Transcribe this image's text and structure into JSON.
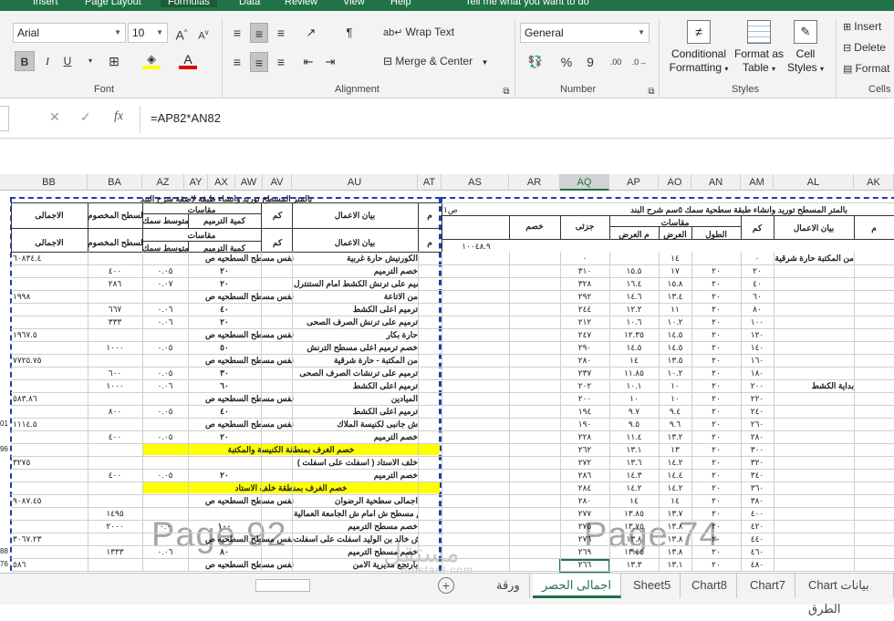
{
  "ribbon_tabs": [
    "Insert",
    "Page Layout",
    "Formulas",
    "Data",
    "Review",
    "View",
    "Help",
    "Tell me what you want to do"
  ],
  "font": {
    "name": "Arial",
    "size": "10",
    "group_label": "Font",
    "bold": "B",
    "italic": "I",
    "underline": "U",
    "grow": "A",
    "shrink": "A"
  },
  "alignment": {
    "wrap_text": "Wrap Text",
    "merge_center": "Merge & Center",
    "group_label": "Alignment"
  },
  "number": {
    "format": "General",
    "percent": "%",
    "comma": "9",
    "inc_dec": ".00",
    "group_label": "Number"
  },
  "styles": {
    "conditional": "Conditional",
    "conditional2": "Formatting",
    "format_as": "Format as",
    "table": "Table",
    "cell": "Cell",
    "cell_styles": "Styles",
    "group_label": "Styles"
  },
  "cells": {
    "insert": "Insert",
    "delete": "Delete",
    "format": "Format",
    "group_label": "Cells"
  },
  "formula_bar": {
    "formula": "=AP82*AN82",
    "fx": "fx"
  },
  "columns": [
    "BB",
    "BA",
    "AZ",
    "AY",
    "AX",
    "AW",
    "AV",
    "AU",
    "AT",
    "AS",
    "AR",
    "AQ",
    "AP",
    "AO",
    "AN",
    "AM",
    "AL",
    "AK"
  ],
  "left_page": {
    "title": "بالمتر المسطح توريد وانشاء طبقة لاصقة شرح البند",
    "headers": {
      "total": "الاجمالى",
      "flat": "السطح المخصوم",
      "quantities": "مقاسات",
      "thickness": "متوسط سمك",
      "restore": "كمية الترميم",
      "km": "كم",
      "items": "بيان الاعمال",
      "m": "م"
    },
    "rows": [
      {
        "total": "٦٠٨٣٤.٤",
        "flat": "",
        "a": "",
        "b": "",
        "label": "الكورنيش حارة غربية",
        "note": "نفس مسطح السطحيه ص"
      },
      {
        "total": "",
        "flat": "٤٠٠",
        "a": "٠.٠٥",
        "b": "٢٠",
        "label": "خصم الترميم",
        "note": ""
      },
      {
        "total": "",
        "flat": "٢٨٦",
        "a": "٠.٠٧",
        "b": "٢٠",
        "label": "ترميم على ترنش الكشط امام الستنترل",
        "note": ""
      },
      {
        "total": "١٩٩٨",
        "flat": "",
        "a": "",
        "b": "",
        "label": "من الاتاعة",
        "note": "نفس مسطح السطحيه ص"
      },
      {
        "total": "",
        "flat": "٦٦٧",
        "a": "٠.٠٦",
        "b": "٤٠",
        "label": "ترميم اعلى الكشط",
        "note": ""
      },
      {
        "total": "",
        "flat": "٣٣٣",
        "a": "٠.٠٦",
        "b": "٢٠",
        "label": "ترميم على ترنش الصرف الصحى",
        "note": ""
      },
      {
        "total": "١٩٦٧.٥",
        "flat": "",
        "a": "",
        "b": "",
        "label": "حارة بكار",
        "note": "نفس مسطح السطحيه ص"
      },
      {
        "total": "",
        "flat": "١٠٠٠",
        "a": "٠.٠٥",
        "b": "٥٠",
        "label": "خصم ترميم اعلى مسطح الترنش",
        "note": ""
      },
      {
        "total": "٧٧٢٥.٧٥",
        "flat": "",
        "a": "",
        "b": "",
        "label": "من المكتبة - حارة شرقية",
        "note": "نفس مسطح السطحيه ص"
      },
      {
        "total": "",
        "flat": "٦٠٠",
        "a": "٠.٠٥",
        "b": "٣٠",
        "label": "ترميم على ترنشات الصرف الصحى",
        "note": ""
      },
      {
        "total": "",
        "flat": "١٠٠٠",
        "a": "٠.٠٦",
        "b": "٦٠",
        "label": "ترميم اعلى الكشط",
        "note": ""
      },
      {
        "total": "٥٨٣.٨٦",
        "flat": "",
        "a": "",
        "b": "",
        "label": "الميادين",
        "note": "نفس مسطح السطحيه ص"
      },
      {
        "total": "",
        "flat": "٨٠٠",
        "a": "٠.٠٥",
        "b": "٤٠",
        "label": "ترميم اعلى الكشط",
        "note": ""
      },
      {
        "total": "١١١٤.٥",
        "flat": "",
        "a": "",
        "b": "",
        "label": "ش جانبى لكنيسة الملاك",
        "note": "نفس مسطح السطحيه ص"
      },
      {
        "total": "",
        "flat": "٤٠٠",
        "a": "٠.٠٥",
        "b": "٢٠",
        "label": "خصم الترميم",
        "note": ""
      },
      {
        "total": "",
        "flat": "",
        "a": "",
        "b": "",
        "label": "",
        "note": "",
        "yellow": "خصم الغرف بمنطقة الكنيسة والمكتبة"
      },
      {
        "total": "٣٢٧٥",
        "flat": "",
        "a": "",
        "b": "",
        "label": "خلف الاستاد ( اسفلت على اسفلت )",
        "note": ""
      },
      {
        "total": "",
        "flat": "٤٠٠",
        "a": "٠.٠٥",
        "b": "٢٠",
        "label": "خصم الترميم",
        "note": ""
      },
      {
        "total": "",
        "flat": "",
        "a": "",
        "b": "",
        "label": "",
        "note": "",
        "yellow": "خصم الغرف بمنطقة خلف الاستاد"
      },
      {
        "total": "٩٠٨٧.٤٥",
        "flat": "",
        "a": "",
        "b": "",
        "label": "اجمالى سطحية الرضوان",
        "note": "نفس مسطح السطحيه ص"
      },
      {
        "total": "",
        "flat": "١٤٩٥",
        "a": "",
        "b": "",
        "label": "خصم مسطح ش امام ش الجامعة العمالية",
        "note": ""
      },
      {
        "total": "",
        "flat": "٢٠٠٠",
        "a": "٠.٠",
        "b": "١٠٠",
        "label": "خصم مسطح الترميم",
        "note": ""
      },
      {
        "total": "٣٠٦٧.٢٣",
        "flat": "",
        "a": "",
        "b": "",
        "label": "سطح ش خالد بن الوليد اسفلت على اسفلت",
        "note": "نفس مسطح السطحيه ص"
      },
      {
        "total": "",
        "flat": "١٣٣٣",
        "a": "٠.٠٦",
        "b": "٨٠",
        "label": "خصم مسطح الترميم",
        "note": ""
      },
      {
        "total": "٥٨٦",
        "flat": "",
        "a": "",
        "b": "",
        "label": "بارتجع مديرية الامن",
        "note": "نفس مسطح السطحيه ص"
      }
    ],
    "left_edge": [
      "",
      "",
      "",
      "",
      "",
      "",
      "",
      "",
      "",
      "",
      "",
      "",
      "",
      "01",
      "",
      "96",
      "",
      "",
      "",
      "",
      "",
      "",
      "",
      "88",
      "76"
    ]
  },
  "right_page": {
    "title": "بالمتر المسطح توريد وانشاء طبقة سطحية سمك ٥سم شرح البند",
    "page_ref": "ص١",
    "headers": {
      "deduct": "خصم",
      "partial": "جزئى",
      "quantities": "مقاسات",
      "avg_width": "م العرض",
      "width": "العرض",
      "length": "الطول",
      "km": "كم",
      "items": "بيان الاعمال",
      "m": "م"
    },
    "subtotal": "١٠٠٤٨.٩",
    "rows": [
      {
        "aq": "٠",
        "ap": "",
        "ao": "١٤",
        "an": "",
        "am": "٠",
        "al": "من المكتبة حارة شرقية"
      },
      {
        "aq": "٣١٠",
        "ap": "١٥.٥",
        "ao": "١٧",
        "an": "٢٠",
        "am": "٢٠",
        "al": ""
      },
      {
        "aq": "٣٢٨",
        "ap": "١٦.٤",
        "ao": "١٥.٨",
        "an": "٢٠",
        "am": "٤٠",
        "al": ""
      },
      {
        "aq": "٢٩٢",
        "ap": "١٤.٦",
        "ao": "١٣.٤",
        "an": "٢٠",
        "am": "٦٠",
        "al": ""
      },
      {
        "aq": "٢٤٤",
        "ap": "١٢.٢",
        "ao": "١١",
        "an": "٢٠",
        "am": "٨٠",
        "al": ""
      },
      {
        "aq": "٢١٢",
        "ap": "١٠.٦",
        "ao": "١٠.٢",
        "an": "٢٠",
        "am": "١٠٠",
        "al": ""
      },
      {
        "aq": "٢٤٧",
        "ap": "١٢.٣٥",
        "ao": "١٤.٥",
        "an": "٢٠",
        "am": "١٢٠",
        "al": ""
      },
      {
        "aq": "٢٩٠",
        "ap": "١٤.٥",
        "ao": "١٤.٥",
        "an": "٢٠",
        "am": "١٤٠",
        "al": ""
      },
      {
        "aq": "٢٨٠",
        "ap": "١٤",
        "ao": "١٣.٥",
        "an": "٢٠",
        "am": "١٦٠",
        "al": ""
      },
      {
        "aq": "٢٣٧",
        "ap": "١١.٨٥",
        "ao": "١٠.٢",
        "an": "٢٠",
        "am": "١٨٠",
        "al": ""
      },
      {
        "aq": "٢٠٢",
        "ap": "١٠.١",
        "ao": "١٠",
        "an": "٢٠",
        "am": "٢٠٠",
        "al": "بداية الكشط"
      },
      {
        "aq": "٢٠٠",
        "ap": "١٠",
        "ao": "١٠",
        "an": "٢٠",
        "am": "٢٢٠",
        "al": ""
      },
      {
        "aq": "١٩٤",
        "ap": "٩.٧",
        "ao": "٩.٤",
        "an": "٢٠",
        "am": "٢٤٠",
        "al": ""
      },
      {
        "aq": "١٩٠",
        "ap": "٩.٥",
        "ao": "٩.٦",
        "an": "٢٠",
        "am": "٢٦٠",
        "al": ""
      },
      {
        "aq": "٢٢٨",
        "ap": "١١.٤",
        "ao": "١٣.٢",
        "an": "٢٠",
        "am": "٢٨٠",
        "al": ""
      },
      {
        "aq": "٢٦٢",
        "ap": "١٣.١",
        "ao": "١٣",
        "an": "٢٠",
        "am": "٣٠٠",
        "al": ""
      },
      {
        "aq": "٢٧٢",
        "ap": "١٣.٦",
        "ao": "١٤.٢",
        "an": "٢٠",
        "am": "٣٢٠",
        "al": ""
      },
      {
        "aq": "٢٨٦",
        "ap": "١٤.٣",
        "ao": "١٤.٤",
        "an": "٢٠",
        "am": "٣٤٠",
        "al": ""
      },
      {
        "aq": "٢٨٤",
        "ap": "١٤.٢",
        "ao": "١٤.٢",
        "an": "٢٠",
        "am": "٣٦٠",
        "al": ""
      },
      {
        "aq": "٢٨٠",
        "ap": "١٤",
        "ao": "١٤",
        "an": "٢٠",
        "am": "٣٨٠",
        "al": ""
      },
      {
        "aq": "٢٧٧",
        "ap": "١٣.٨٥",
        "ao": "١٣.٧",
        "an": "٢٠",
        "am": "٤٠٠",
        "al": ""
      },
      {
        "aq": "٢٧٥",
        "ap": "١٣.٧٥",
        "ao": "١٣.٨",
        "an": "٢٠",
        "am": "٤٢٠",
        "al": ""
      },
      {
        "aq": "٢٧٦",
        "ap": "١٣.٨",
        "ao": "١٣.٨",
        "an": "٢٠",
        "am": "٤٤٠",
        "al": ""
      },
      {
        "aq": "٢٦٩",
        "ap": "١٣.٤٥",
        "ao": "١٣.٨",
        "an": "٢٠",
        "am": "٤٦٠",
        "al": ""
      },
      {
        "aq": "٢٦٦",
        "ap": "١٣.٣",
        "ao": "١٣.١",
        "an": "٢٠",
        "am": "٤٨٠",
        "al": ""
      }
    ]
  },
  "watermarks": {
    "left": "Page 92",
    "right": "Page 74",
    "brand": "مستقل",
    "brand_url": "mostaql.com"
  },
  "sheet_tabs": [
    "ورقة",
    "اجمالى الحصر",
    "Sheet5",
    "Chart8",
    "Chart7",
    "Chart بيانات الطرق"
  ],
  "active_sheet": "اجمالى الحصر",
  "add_sheet": "+"
}
